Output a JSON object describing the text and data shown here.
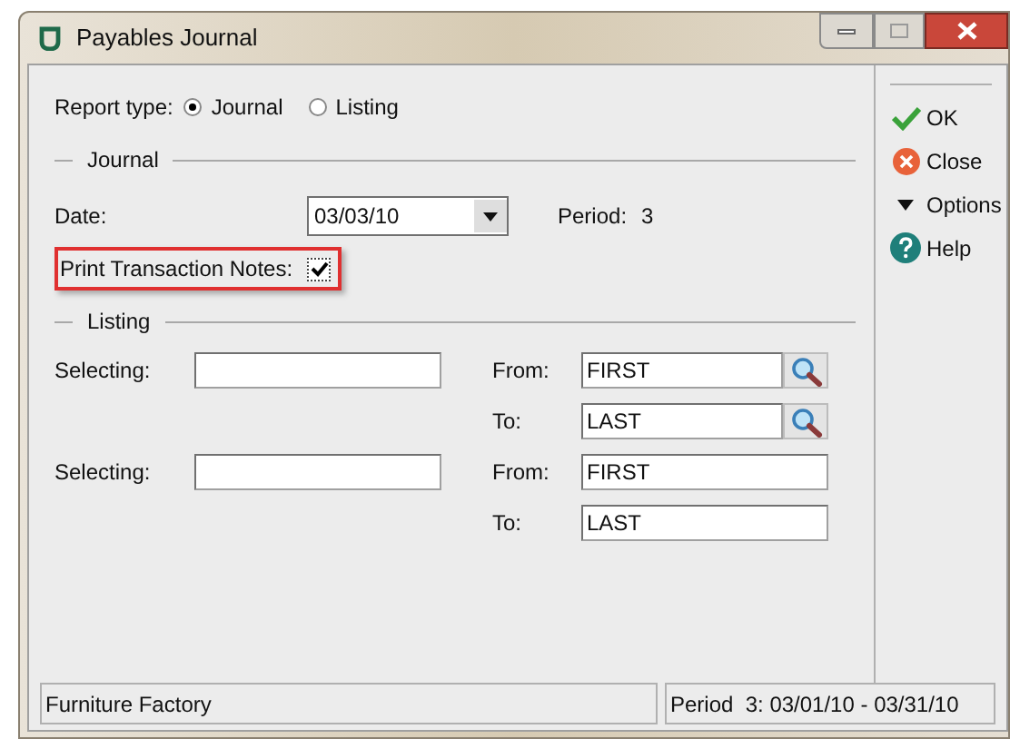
{
  "window": {
    "title": "Payables Journal"
  },
  "report_type": {
    "label": "Report type:",
    "options": [
      {
        "label": "Journal",
        "selected": true
      },
      {
        "label": "Listing",
        "selected": false
      }
    ]
  },
  "journal": {
    "heading": "Journal",
    "date_label": "Date:",
    "date_value": "03/03/10",
    "period_label": "Period:",
    "period_value": "3",
    "print_notes": {
      "label": "Print Transaction Notes:",
      "checked": true,
      "highlighted": true
    }
  },
  "listing": {
    "heading": "Listing",
    "rows": [
      {
        "selecting_label": "Selecting:",
        "selecting_value": "",
        "from_label": "From:",
        "from_value": "FIRST",
        "to_label": "To:",
        "to_value": "LAST",
        "lookup": true
      },
      {
        "selecting_label": "Selecting:",
        "selecting_value": "",
        "from_label": "From:",
        "from_value": "FIRST",
        "to_label": "To:",
        "to_value": "LAST",
        "lookup": false
      }
    ]
  },
  "actions": [
    {
      "kind": "ok",
      "label": "OK"
    },
    {
      "kind": "close",
      "label": "Close"
    },
    {
      "kind": "options",
      "label": "Options"
    },
    {
      "kind": "help",
      "label": "Help"
    }
  ],
  "status_bar": {
    "company": "Furniture Factory",
    "period": "Period  3: 03/01/10 - 03/31/10"
  }
}
